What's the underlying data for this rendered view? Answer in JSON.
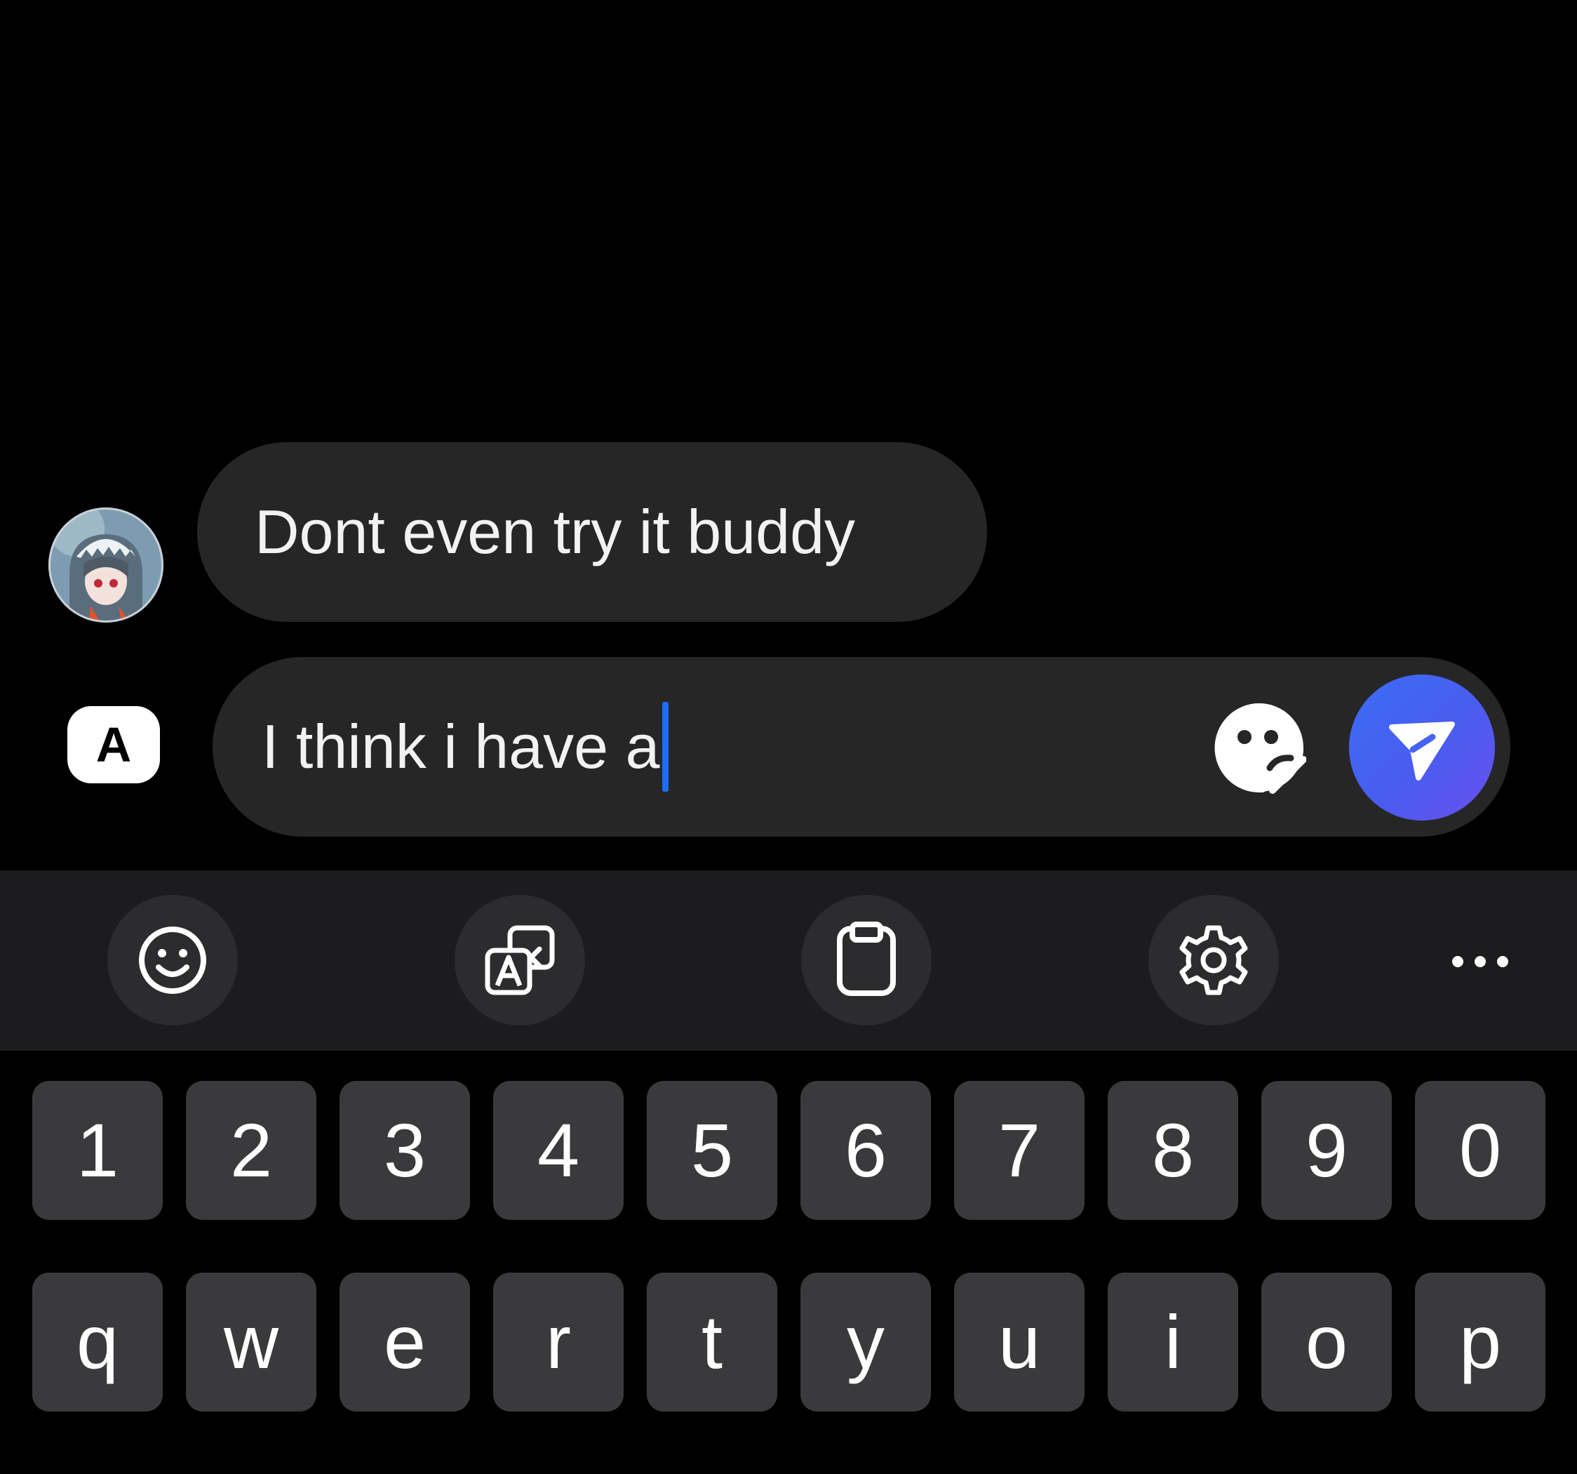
{
  "conversation": {
    "incoming_message": {
      "text": "Dont even try it buddy",
      "avatar": "avatar-anime-character"
    }
  },
  "composer": {
    "translate_badge_label": "A",
    "input_value": "I think i have a",
    "sticker_icon": "sticker-icon",
    "send_icon": "send-icon"
  },
  "keyboard": {
    "toolbar": [
      {
        "name": "emoji",
        "icon": "smiley-icon"
      },
      {
        "name": "translate",
        "icon": "translate-icon"
      },
      {
        "name": "clipboard",
        "icon": "clipboard-icon"
      },
      {
        "name": "settings",
        "icon": "gear-icon"
      },
      {
        "name": "more",
        "icon": "more-dots-icon"
      }
    ],
    "number_row": [
      "1",
      "2",
      "3",
      "4",
      "5",
      "6",
      "7",
      "8",
      "9",
      "0"
    ],
    "letter_row": [
      "q",
      "w",
      "e",
      "r",
      "t",
      "y",
      "u",
      "i",
      "o",
      "p"
    ]
  },
  "colors": {
    "background": "#000000",
    "bubble": "#262626",
    "key": "#3a3a3c",
    "toolbar": "#1c1c1e",
    "accent": "#3b6df6",
    "caret": "#1d6dff"
  }
}
